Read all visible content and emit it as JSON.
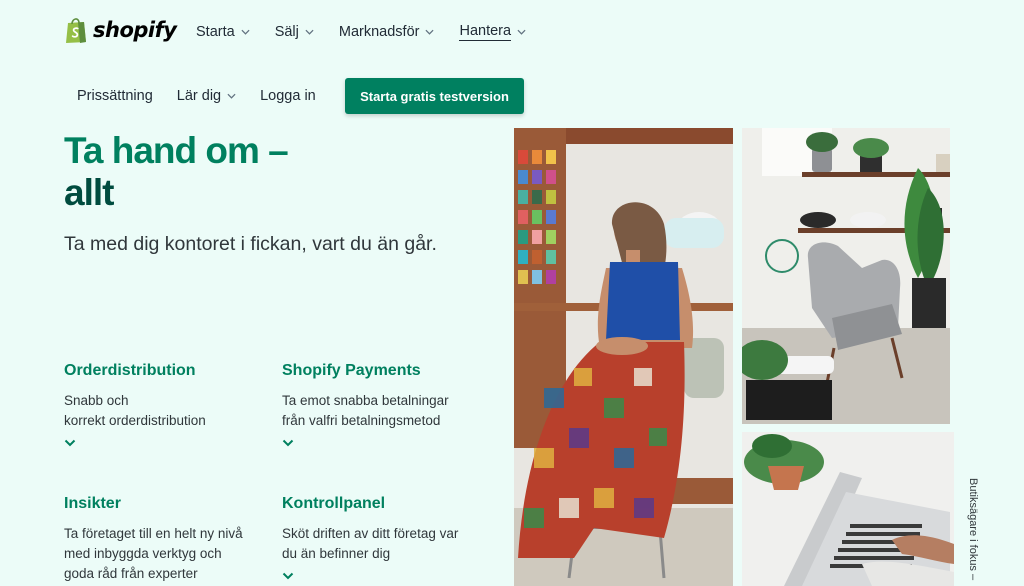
{
  "brand": {
    "name": "shopify",
    "color": "#95bf47"
  },
  "topnav": [
    {
      "label": "Starta",
      "active": false
    },
    {
      "label": "Sälj",
      "active": false
    },
    {
      "label": "Marknadsför",
      "active": false
    },
    {
      "label": "Hantera",
      "active": true
    }
  ],
  "subnav": {
    "pricing": "Prissättning",
    "learn": "Lär dig",
    "login": "Logga in",
    "cta": "Starta gratis testversion"
  },
  "hero": {
    "title_line1": "Ta hand om –",
    "title_line2": "allt",
    "subtitle": "Ta med dig kontoret i fickan, vart du än går."
  },
  "features": [
    {
      "title": "Orderdistribution",
      "description": "Snabb och\nkorrekt orderdistribution"
    },
    {
      "title": "Shopify Payments",
      "description": "Ta emot snabba betalningar\nfrån valfri betalningsmetod"
    },
    {
      "title": "Insikter",
      "description": "Ta företaget till en helt ny nivå\nmed inbyggda verktyg och\ngoda råd från experter"
    },
    {
      "title": "Kontrollpanel",
      "description": "Sköt driften av ditt företag var\ndu än befinner dig"
    }
  ],
  "side_label": "Butiksägare i fokus –",
  "colors": {
    "accent": "#008060",
    "heading_dark": "#004c3f",
    "background": "#ecfcf8"
  }
}
